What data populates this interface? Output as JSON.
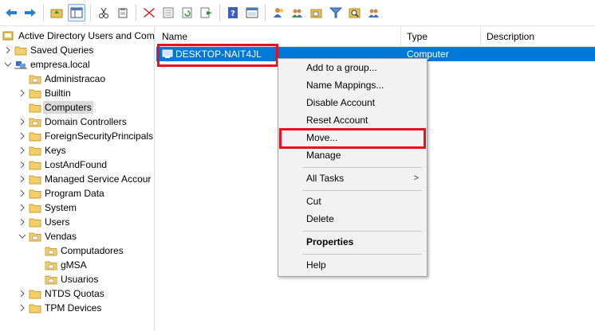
{
  "toolbar": {
    "buttons": [
      "back-arrow-icon",
      "forward-arrow-icon",
      "folder-up-icon",
      "show-hide-tree-icon",
      "cut-icon",
      "copy-icon",
      "delete-icon",
      "properties-icon",
      "refresh-icon",
      "export-list-icon",
      "help-icon",
      "toggle-pane-icon",
      "new-user-icon",
      "new-group-icon",
      "new-ou-icon",
      "filter-icon",
      "find-icon",
      "add-to-group-icon"
    ]
  },
  "tree": {
    "root": "Active Directory Users and Com",
    "saved_queries": "Saved Queries",
    "domain": "empresa.local",
    "items": {
      "administracao": "Administracao",
      "builtin": "Builtin",
      "computers": "Computers",
      "domain_controllers": "Domain Controllers",
      "foreign": "ForeignSecurityPrincipals",
      "keys": "Keys",
      "lostandfound": "LostAndFound",
      "managed_service": "Managed Service Accour",
      "program_data": "Program Data",
      "system": "System",
      "users": "Users",
      "vendas": "Vendas",
      "computadores": "Computadores",
      "gmsa": "gMSA",
      "usuarios": "Usuarios",
      "ntds_quotas": "NTDS Quotas",
      "tpm_devices": "TPM Devices"
    }
  },
  "list": {
    "headers": {
      "name": "Name",
      "type": "Type",
      "description": "Description"
    },
    "row": {
      "name": "DESKTOP-NAIT4JL",
      "type": "Computer",
      "description": ""
    }
  },
  "context_menu": {
    "add_to_group": "Add to a group...",
    "name_mappings": "Name Mappings...",
    "disable_account": "Disable Account",
    "reset_account": "Reset Account",
    "move": "Move...",
    "manage": "Manage",
    "all_tasks": "All Tasks",
    "all_tasks_arrow": ">",
    "cut": "Cut",
    "delete": "Delete",
    "properties": "Properties",
    "help": "Help"
  },
  "colors": {
    "selection": "#0078d7",
    "highlight_box": "#e8101a",
    "folder": "#e8c25a"
  }
}
